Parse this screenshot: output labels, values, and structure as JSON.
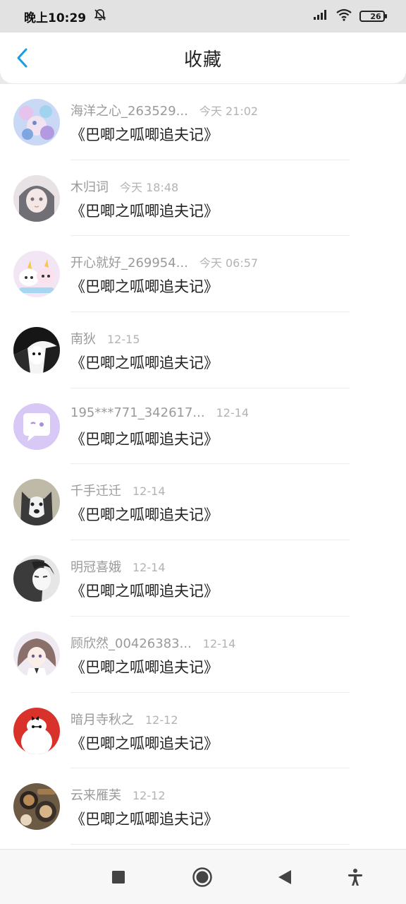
{
  "status_bar": {
    "time": "晚上10:29",
    "battery_level": "26"
  },
  "header": {
    "title": "收藏"
  },
  "items": [
    {
      "name": "海洋之心_263529...",
      "time": "今天 21:02",
      "text": "《巴唧之呱唧追夫记》",
      "avatar": "avatar-anime-blue"
    },
    {
      "name": "木归词",
      "time": "今天 18:48",
      "text": "《巴唧之呱唧追夫记》",
      "avatar": "avatar-anime-girl"
    },
    {
      "name": "开心就好_269954...",
      "time": "今天 06:57",
      "text": "《巴唧之呱唧追夫记》",
      "avatar": "avatar-unicorns"
    },
    {
      "name": "南狄",
      "time": "12-15",
      "text": "《巴唧之呱唧追夫记》",
      "avatar": "avatar-manga-bw"
    },
    {
      "name": "195***771_342617...",
      "time": "12-14",
      "text": "《巴唧之呱唧追夫记》",
      "avatar": "avatar-default-chat"
    },
    {
      "name": "千手迁迁",
      "time": "12-14",
      "text": "《巴唧之呱唧追夫记》",
      "avatar": "avatar-husky"
    },
    {
      "name": "明冠喜娥",
      "time": "12-14",
      "text": "《巴唧之呱唧追夫记》",
      "avatar": "avatar-bw-photo"
    },
    {
      "name": "顾欣然_00426383...",
      "time": "12-14",
      "text": "《巴唧之呱唧追夫记》",
      "avatar": "avatar-anime-white"
    },
    {
      "name": "暗月寺秋之",
      "time": "12-12",
      "text": "《巴唧之呱唧追夫记》",
      "avatar": "avatar-baymax"
    },
    {
      "name": "云来雁芙",
      "time": "12-12",
      "text": "《巴唧之呱唧追夫记》",
      "avatar": "avatar-food"
    }
  ],
  "nav_bar": {
    "buttons": [
      "recents-button",
      "home-button",
      "back-button",
      "accessibility-button"
    ]
  },
  "colors": {
    "accent": "#1a9be6",
    "title": "#222222",
    "meta": "#999999",
    "divider": "#ededed"
  }
}
